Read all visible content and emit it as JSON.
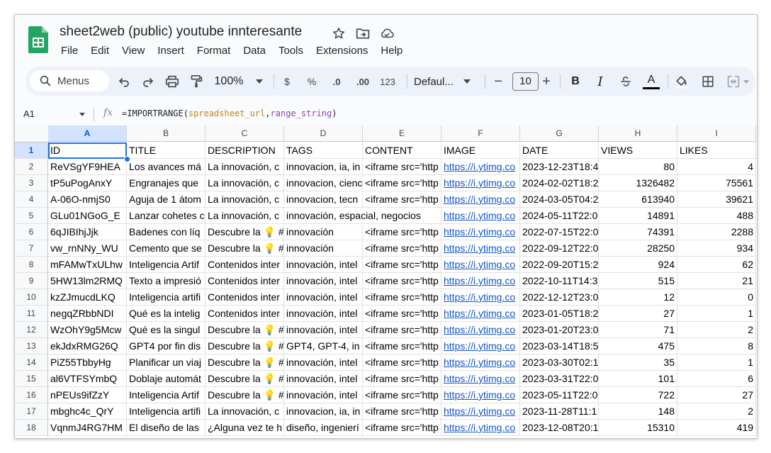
{
  "app": {
    "doc_title": "sheet2web (public) youtube innteresante",
    "menu": [
      "File",
      "Edit",
      "View",
      "Insert",
      "Format",
      "Data",
      "Tools",
      "Extensions",
      "Help"
    ]
  },
  "toolbar": {
    "search_label": "Menus",
    "zoom": "100%",
    "currency": "$",
    "percent": "%",
    "decrease_decimal": ".0",
    "increase_decimal": ".00",
    "number_format": "123",
    "font": "Defaul...",
    "font_size": "10",
    "minus": "−",
    "plus": "+",
    "bold": "B",
    "italic": "I",
    "text_color_label": "A"
  },
  "formula_bar": {
    "cell_ref": "A1",
    "fx": "fx",
    "formula_prefix": "=IMPORTRANGE(",
    "arg1": "spreadsheet_url",
    "comma": ",",
    "arg2": "range_string",
    "formula_suffix": ")"
  },
  "grid": {
    "columns": [
      "A",
      "B",
      "C",
      "D",
      "E",
      "F",
      "G",
      "H",
      "I"
    ],
    "rows": [
      [
        "ID",
        "TITLE",
        "DESCRIPTION",
        "TAGS",
        "CONTENT",
        "IMAGE",
        "DATE",
        "VIEWS",
        "LIKES"
      ],
      [
        "ReVSgYF9HEA",
        "Los avances má",
        "La innovación, c",
        "innovacion, ia, in",
        "<iframe src='http",
        "https://i.ytimg.co",
        "2023-12-23T18:4",
        "80",
        "4"
      ],
      [
        "tP5uPogAnxY",
        "Engranajes que",
        "La innovación, c",
        "innovacion, cienc",
        "<iframe src='http",
        "https://i.ytimg.co",
        "2024-02-02T18:2",
        "1326482",
        "75561"
      ],
      [
        "A-06O-nmjS0",
        "Aguja de 1 átom",
        "La innovación, c",
        "innovacion, tecn",
        "<iframe src='http",
        "https://i.ytimg.co",
        "2024-03-05T04:2",
        "613940",
        "39621"
      ],
      [
        "GLu01NGoG_E",
        "Lanzar cohetes c",
        "La innovación, c",
        "innovación, espacial, negocios",
        "",
        "https://i.ytimg.co",
        "2024-05-11T22:0",
        "14891",
        "488"
      ],
      [
        "6qJIBIhjJjk",
        "Badenes con líq",
        "Descubre la 💡 #",
        "innovación",
        "<iframe src='http",
        "https://i.ytimg.co",
        "2022-07-15T22:0",
        "74391",
        "2288"
      ],
      [
        "vw_rnNNy_WU",
        "Cemento que se",
        "Descubre la 💡 #",
        "innovación",
        "<iframe src='http",
        "https://i.ytimg.co",
        "2022-09-12T22:0",
        "28250",
        "934"
      ],
      [
        "mFAMwTxULhw",
        "Inteligencia Artif",
        "Contenidos inter",
        "innovación, intel",
        "<iframe src='http",
        "https://i.ytimg.co",
        "2022-09-20T15:2",
        "924",
        "62"
      ],
      [
        "5HW13lm2RMQ",
        "Texto a impresió",
        "Contenidos inter",
        "innovación, intel",
        "<iframe src='http",
        "https://i.ytimg.co",
        "2022-10-11T14:3",
        "515",
        "21"
      ],
      [
        "kzZJmucdLKQ",
        "Inteligencia artifi",
        "Contenidos inter",
        "innovación, intel",
        "<iframe src='http",
        "https://i.ytimg.co",
        "2022-12-12T23:0",
        "12",
        "0"
      ],
      [
        "negqZRbbNDI",
        "Qué es la intelig",
        "Contenidos inter",
        "innovación, intel",
        "<iframe src='http",
        "https://i.ytimg.co",
        "2023-01-05T18:2",
        "27",
        "1"
      ],
      [
        "WzOhY9g5Mcw",
        "Qué es la singul",
        "Descubre la 💡 #",
        "innovación, intel",
        "<iframe src='http",
        "https://i.ytimg.co",
        "2023-01-20T23:0",
        "71",
        "2"
      ],
      [
        "ekJdxRMG26Q",
        "GPT4 por fin dis",
        "Descubre la 💡 #",
        "GPT4, GPT-4, in",
        "<iframe src='http",
        "https://i.ytimg.co",
        "2023-03-14T18:5",
        "475",
        "8"
      ],
      [
        "PiZ55TbbyHg",
        "Planificar un viaj",
        "Descubre la 💡 #",
        "innovación, intel",
        "<iframe src='http",
        "https://i.ytimg.co",
        "2023-03-30T02:1",
        "35",
        "1"
      ],
      [
        "al6VTFSYmbQ",
        "Doblaje automát",
        "Descubre la 💡 #",
        "innovación, intel",
        "<iframe src='http",
        "https://i.ytimg.co",
        "2023-03-31T22:0",
        "101",
        "6"
      ],
      [
        "nPEUs9ifZzY",
        "Inteligencia Artif",
        "Descubre la 💡 #",
        "innovación, intel",
        "<iframe src='http",
        "https://i.ytimg.co",
        "2023-05-11T22:0",
        "722",
        "27"
      ],
      [
        "mbghc4c_QrY",
        "Inteligencia artifi",
        "La innovación, c",
        "innovacion, ia, in",
        "<iframe src='http",
        "https://i.ytimg.co",
        "2023-11-28T11:1",
        "148",
        "2"
      ],
      [
        "VqnmJ4RG7HM",
        "El diseño de las",
        "¿Alguna vez te h",
        "diseño, ingenierí",
        "<iframe src='http",
        "https://i.ytimg.co",
        "2023-12-08T20:1",
        "15310",
        "419"
      ]
    ]
  }
}
